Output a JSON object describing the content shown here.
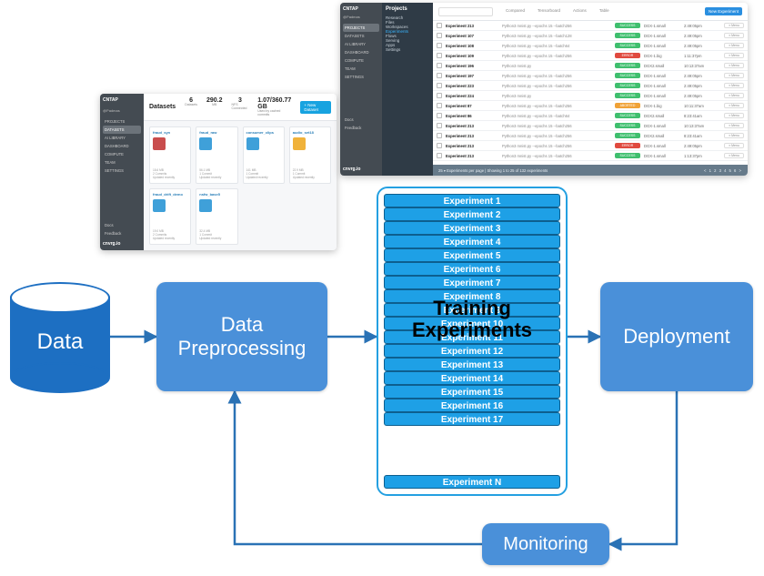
{
  "pipeline": {
    "data": "Data",
    "preprocessing": "Data\nPreprocessing",
    "training_title": "Training\nExperiments",
    "deployment": "Deployment",
    "monitoring": "Monitoring",
    "experiments": [
      "Experiment 1",
      "Experiment 2",
      "Experiment 3",
      "Experiment 4",
      "Experiment 5",
      "Experiment 6",
      "Experiment 7",
      "Experiment 8",
      "Experiment 9",
      "Experiment 10",
      "Experiment 11",
      "Experiment 12",
      "Experiment 13",
      "Experiment 14",
      "Experiment 15",
      "Experiment 16",
      "Experiment 17"
    ],
    "experiment_last": "Experiment N"
  },
  "ds_shot": {
    "brand": "CNTAP",
    "user": "@Padmas",
    "nav": [
      "PROJECTS",
      "DATASETS",
      "AI LIBRARY",
      "DASHBOARD",
      "COMPUTE",
      "TEAM",
      "SETTINGS"
    ],
    "nav_active": "DATASETS",
    "footer_links": [
      "Docs",
      "Feedback"
    ],
    "logo": "cnvrg.io",
    "title": "Datasets",
    "stats": [
      {
        "n": "6",
        "l": "Datasets"
      },
      {
        "n": "290.2",
        "l": "MB"
      },
      {
        "n": "3",
        "l": "NFS Connected"
      },
      {
        "n": "1.07/360.77 GB",
        "l": "Used by cached commits"
      }
    ],
    "new_btn": "+ New Dataset",
    "cards": [
      {
        "name": "fraud_syn",
        "color": "#c94d4d",
        "meta": "18.6 MB\n2 Commits\nUpdated recently"
      },
      {
        "name": "fraud_raw",
        "color": "#3fa0d9",
        "meta": "56.1 MB\n1 Commit\nUpdated recently"
      },
      {
        "name": "consumer_clips",
        "color": "#3fa0d9",
        "meta": "141 MB\n1 Commit\nUpdated recently"
      },
      {
        "name": "audio_set18",
        "color": "#f0b23a",
        "meta": "22.9 MB\n1 Commit\nUpdated recently"
      },
      {
        "name": "fraud_drift_demo",
        "color": "#3fa0d9",
        "meta": "19.0 MB\n2 Commits\nUpdated recently"
      },
      {
        "name": "nsfw_base5",
        "color": "#3fa0d9",
        "meta": "32.4 MB\n1 Commit\nUpdated recently"
      }
    ]
  },
  "ex_shot": {
    "brand": "CNTAP",
    "user": "@Padmas",
    "nav": [
      "PROJECTS",
      "DATASETS",
      "AI LIBRARY",
      "DASHBOARD",
      "COMPUTE",
      "TEAM",
      "SETTINGS"
    ],
    "nav_active": "PROJECTS",
    "footer_links": [
      "Docs",
      "Feedback"
    ],
    "logo": "cnvrg.io",
    "subnav_title": "Projects",
    "subnav": [
      "Research",
      "Files",
      "Workspaces",
      "Experiments",
      "Flows",
      "Serving",
      "Apps",
      "Settings"
    ],
    "subnav_active": "Experiments",
    "toolbar": {
      "search_placeholder": "Search",
      "compared": "Compared",
      "tensorboard": "Tensorboard",
      "actions": "Actions",
      "table": "Table",
      "new_btn": "New Experiment"
    },
    "rows": [
      {
        "name": "Experiment 213",
        "cmd": "Python3 mnist.py --epochs 15 --batch256",
        "status": "success",
        "status_label": "SUCCESS",
        "inst": "DGX-1.small",
        "time": "2:49:05pm"
      },
      {
        "name": "Experiment 107",
        "cmd": "Python3 mnist.py --epochs 15 --batch128",
        "status": "success",
        "status_label": "SUCCESS",
        "inst": "DGX-1.small",
        "time": "2:49:05pm"
      },
      {
        "name": "Experiment 108",
        "cmd": "Python3 mnist.py --epochs 15 --batch64",
        "status": "success",
        "status_label": "SUCCESS",
        "inst": "DGX-1.small",
        "time": "2:49:05pm"
      },
      {
        "name": "Experiment 109",
        "cmd": "Python3 mnist.py --epochs 15 --batch256",
        "status": "error",
        "status_label": "ERROR",
        "inst": "DGX-1.big",
        "time": "1:11:37pm"
      },
      {
        "name": "Experiment 196",
        "cmd": "Python3 mnist.py",
        "status": "success",
        "status_label": "SUCCESS",
        "inst": "DGX2.small",
        "time": "10:13:37am"
      },
      {
        "name": "Experiment 197",
        "cmd": "Python3 mnist.py --epochs 15 --batch256",
        "status": "success",
        "status_label": "SUCCESS",
        "inst": "DGX-1.small",
        "time": "2:49:05pm"
      },
      {
        "name": "Experiment 223",
        "cmd": "Python3 mnist.py --epochs 15 --batch256",
        "status": "success",
        "status_label": "SUCCESS",
        "inst": "DGX-1.small",
        "time": "2:49:05pm"
      },
      {
        "name": "Experiment 224",
        "cmd": "Python3 mnist.py",
        "status": "success",
        "status_label": "SUCCESS",
        "inst": "DGX-1.small",
        "time": "2:49:05pm"
      },
      {
        "name": "Experiment 87",
        "cmd": "Python3 mnist.py --epochs 15 --batch256",
        "status": "aborted",
        "status_label": "ABORTED",
        "inst": "DGX-1.big",
        "time": "10:11:37am"
      },
      {
        "name": "Experiment 86",
        "cmd": "Python3 mnist.py --epochs 15 --batch64",
        "status": "success",
        "status_label": "SUCCESS",
        "inst": "DGX2.small",
        "time": "8:23:41am"
      },
      {
        "name": "Experiment 213",
        "cmd": "Python3 mnist.py --epochs 15 --batch256",
        "status": "success",
        "status_label": "SUCCESS",
        "inst": "DGX-1.small",
        "time": "10:13:37am"
      },
      {
        "name": "Experiment 213",
        "cmd": "Python3 mnist.py --epochs 15 --batch256",
        "status": "success",
        "status_label": "SUCCESS",
        "inst": "DGX2.small",
        "time": "8:23:41am"
      },
      {
        "name": "Experiment 213",
        "cmd": "Python3 mnist.py --epochs 15 --batch256",
        "status": "error",
        "status_label": "ERROR",
        "inst": "DGX-1.small",
        "time": "2:49:05pm"
      },
      {
        "name": "Experiment 213",
        "cmd": "Python3 mnist.py --epochs 15 --batch256",
        "status": "success",
        "status_label": "SUCCESS",
        "inst": "DGX-1.small",
        "time": "1:13:37pm"
      }
    ],
    "menu_label": "Menu",
    "footer": {
      "left": "25 ▾  Experiments per page | Showing 1 to 25 of 132 experiments",
      "right": "< 1 2 3 4 5 6 >"
    }
  }
}
